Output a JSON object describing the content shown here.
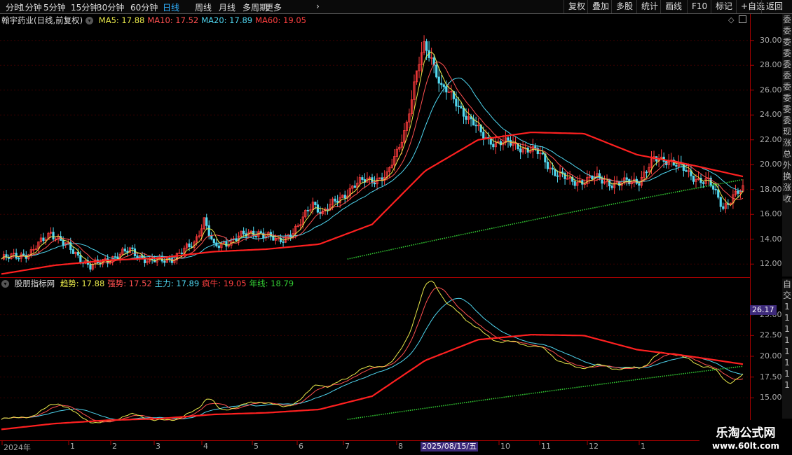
{
  "toolbar": {
    "periods": [
      "分时",
      "1分钟",
      "5分钟",
      "15分钟",
      "30分钟",
      "60分钟",
      "日线",
      "周线",
      "月线",
      "多周期",
      "更多"
    ],
    "active_period": "日线",
    "more_arrow": "›",
    "controls": [
      "复权",
      "叠加",
      "多股",
      "统计",
      "画线",
      "F10",
      "标记",
      "+自选",
      "返回"
    ]
  },
  "main_panel": {
    "stock_title": "翰宇药业(日线,前复权)",
    "indicators": [
      {
        "label": "MA5: 17.88",
        "color": "#e8e84a"
      },
      {
        "label": "MA10: 17.52",
        "color": "#ff5050"
      },
      {
        "label": "MA20: 17.89",
        "color": "#4fd6f0"
      },
      {
        "label": "MA60: 19.05",
        "color": "#ff4040"
      }
    ],
    "diamond_icon": "diamond-icon",
    "y_ticks": [
      "30.00",
      "28.00",
      "26.00",
      "24.00",
      "22.00",
      "20.00",
      "18.00",
      "16.00",
      "14.00",
      "12.00"
    ],
    "right_strip_chars": [
      "委",
      "委",
      "委",
      "委",
      "委",
      "委",
      "委",
      "委",
      "委",
      "委",
      "现",
      "涨",
      "总",
      "外",
      "换",
      "涨",
      "收"
    ]
  },
  "sub_panel": {
    "name": "股朋指标网",
    "indicators": [
      {
        "label": "趋势: 17.88",
        "color": "#e8e84a"
      },
      {
        "label": "强势: 17.52",
        "color": "#ff5050"
      },
      {
        "label": "主力: 17.89",
        "color": "#4fd6f0"
      },
      {
        "label": "疯牛: 19.05",
        "color": "#ff4040"
      },
      {
        "label": "年线: 18.79",
        "color": "#33cc33"
      }
    ],
    "price_marker": "26.17",
    "y_ticks": [
      "25.00",
      "22.50",
      "20.00",
      "17.50",
      "15.00"
    ],
    "right_strip_chars": [
      "自",
      "交",
      "1",
      "1",
      "1",
      "1",
      "1",
      "1",
      "1",
      "1"
    ]
  },
  "x_axis": {
    "labels": [
      "2024年",
      "1",
      "2",
      "3",
      "4",
      "5",
      "6",
      "7",
      "8",
      "10",
      "11",
      "12",
      "1"
    ],
    "highlight_date": "2025/08/15/五"
  },
  "watermark": {
    "line1": "乐淘公式网",
    "line2": "www.60lt.com"
  },
  "colors": {
    "up": "#ff3c3c",
    "down": "#53d8f0",
    "ma5": "#e8e84a",
    "ma10": "#ff5050",
    "ma20": "#4fd6f0",
    "ma60": "#ff2020",
    "year": "#33cc33",
    "grid": "#3a0000"
  },
  "chart_data": {
    "type": "line",
    "title": "翰宇药业(日线,前复权)",
    "x": [
      "2024-12",
      "2025-01",
      "2025-02",
      "2025-03",
      "2025-04",
      "2025-05",
      "2025-06",
      "2025-07",
      "2025-08",
      "2025-09",
      "2025-10",
      "2025-11",
      "2025-12",
      "2026-01",
      "2026-02"
    ],
    "series": [
      {
        "name": "MA5",
        "values": [
          12.6,
          13.2,
          12.0,
          12.4,
          14.8,
          13.9,
          14.5,
          17.6,
          27.0,
          22.5,
          21.2,
          18.7,
          18.6,
          20.4,
          17.9
        ]
      },
      {
        "name": "MA10",
        "values": [
          12.5,
          13.0,
          12.1,
          12.3,
          14.5,
          13.9,
          14.3,
          17.2,
          26.0,
          22.9,
          21.3,
          18.8,
          18.6,
          20.1,
          17.5
        ]
      },
      {
        "name": "MA20",
        "values": [
          12.3,
          12.9,
          12.2,
          12.3,
          14.0,
          13.8,
          14.1,
          16.6,
          24.5,
          23.0,
          21.5,
          19.2,
          18.6,
          19.5,
          17.9
        ]
      },
      {
        "name": "MA60",
        "values": [
          11.2,
          11.9,
          12.3,
          12.5,
          13.0,
          13.2,
          13.6,
          15.2,
          19.5,
          22.0,
          22.6,
          22.5,
          20.8,
          20.0,
          19.05
        ]
      }
    ],
    "ylim": [
      11.0,
      31.0
    ]
  }
}
